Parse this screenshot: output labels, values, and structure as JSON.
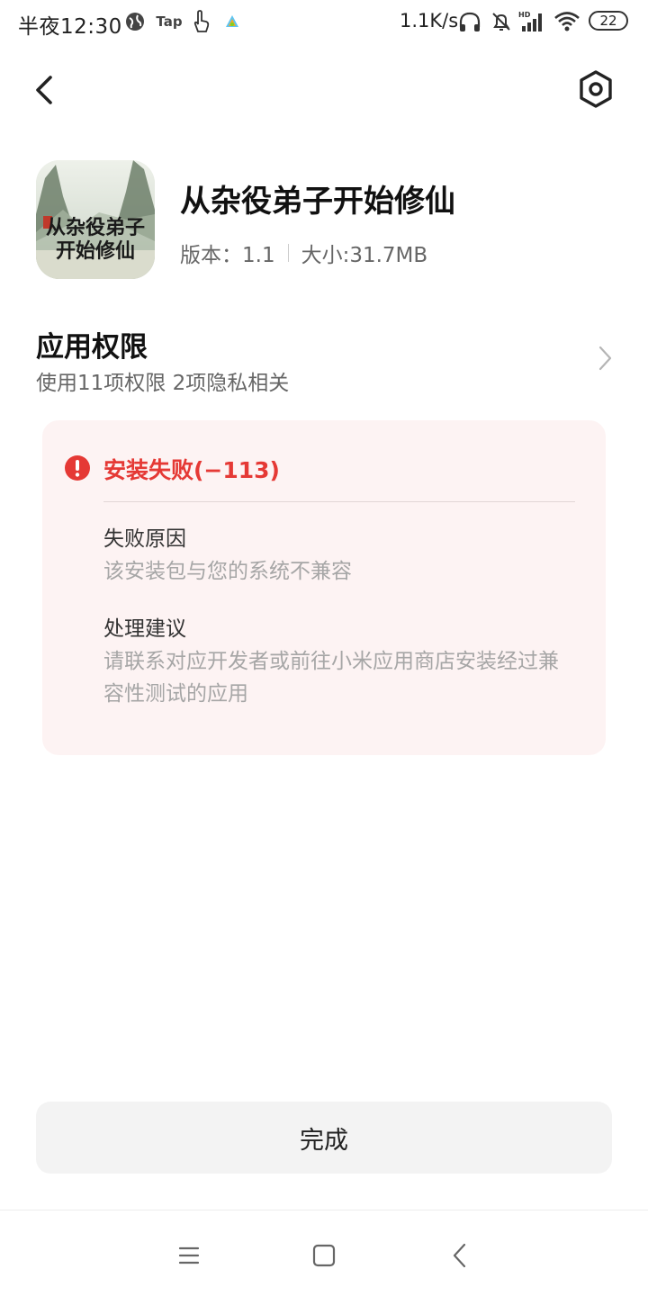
{
  "status_bar": {
    "time": "半夜12:30",
    "tap_label": "Tap",
    "network_speed": "1.1K/s",
    "battery": "22",
    "icons": [
      "globe-icon",
      "tap-icon",
      "hand-touch-icon",
      "app-notify-icon",
      "headphones-icon",
      "mute-bell-icon",
      "hd-signal-icon",
      "wifi-icon",
      "battery-icon"
    ]
  },
  "header": {
    "back_icon": "chevron-left-icon",
    "settings_icon": "hexagon-settings-icon"
  },
  "app": {
    "name": "从杂役弟子开始修仙",
    "version_label": "版本：1.1",
    "size_label": "大小:31.7MB",
    "icon_text_line1": "从杂役弟子",
    "icon_text_line2": "开始修仙"
  },
  "permissions": {
    "title": "应用权限",
    "subtitle": "使用11项权限 2项隐私相关"
  },
  "error": {
    "title": "安装失败(−113)",
    "reason_label": "失败原因",
    "reason_text": "该安装包与您的系统不兼容",
    "advice_label": "处理建议",
    "advice_text": "请联系对应开发者或前往小米应用商店安装经过兼容性测试的应用",
    "accent_color": "#e53935"
  },
  "done_button": {
    "label": "完成"
  },
  "nav_bar": {
    "icons": [
      "menu-icon",
      "home-square-icon",
      "back-chevron-icon"
    ]
  }
}
